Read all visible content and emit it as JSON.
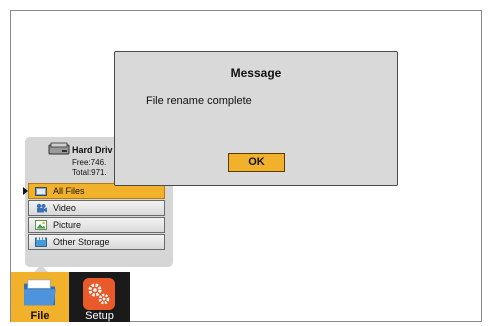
{
  "dialog": {
    "title": "Message",
    "message": "File rename complete",
    "ok_label": "OK"
  },
  "storage": {
    "drive_name": "Hard Driv",
    "free": "Free:746.",
    "total": "Total:971.",
    "items": [
      {
        "label": "All Files",
        "icon": "all-files-icon",
        "selected": true
      },
      {
        "label": "Video",
        "icon": "video-icon",
        "selected": false
      },
      {
        "label": "Picture",
        "icon": "picture-icon",
        "selected": false
      },
      {
        "label": "Other Storage",
        "icon": "other-storage-icon",
        "selected": false
      }
    ]
  },
  "tabs": [
    {
      "label": "File",
      "icon": "folder-icon",
      "active": true
    },
    {
      "label": "Setup",
      "icon": "gears-icon",
      "active": false
    }
  ],
  "colors": {
    "accent": "#f2b12a",
    "panel": "#d6d6d6",
    "dialog": "#d9d9d9",
    "setup_tab": "#1a1a1a",
    "setup_icon": "#e85a2a"
  }
}
